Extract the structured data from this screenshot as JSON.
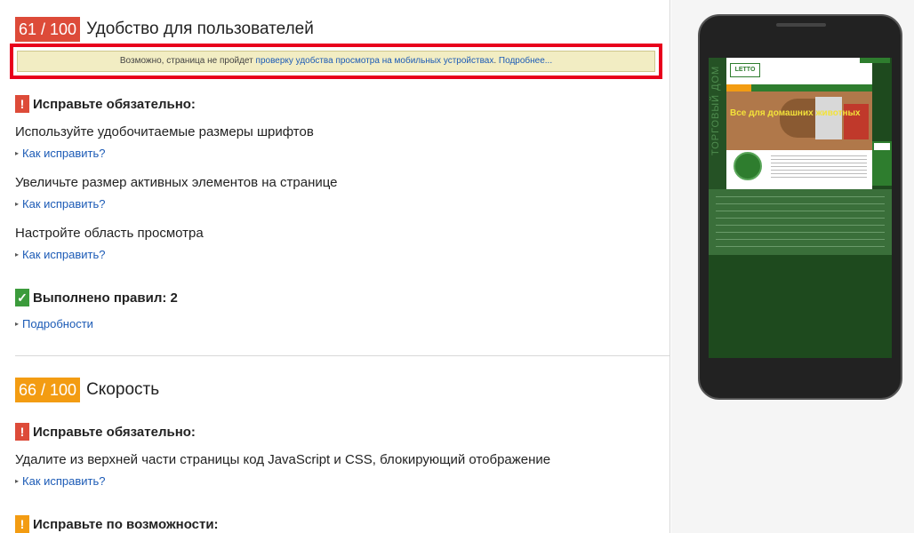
{
  "usability": {
    "score": "61 / 100",
    "title": "Удобство для пользователей",
    "warning_text": "Возможно, страница не пройдет",
    "warning_link": "проверку удобства просмотра на мобильных устройствах",
    "warning_more": "Подробнее...",
    "must_fix_label": "Исправьте обязательно:",
    "items": [
      {
        "text": "Используйте удобочитаемые размеры шрифтов",
        "link": "Как исправить?"
      },
      {
        "text": "Увеличьте размер активных элементов на странице",
        "link": "Как исправить?"
      },
      {
        "text": "Настройте область просмотра",
        "link": "Как исправить?"
      }
    ],
    "passed_label": "Выполнено правил: 2",
    "details_link": "Подробности"
  },
  "speed": {
    "score": "66 / 100",
    "title": "Скорость",
    "must_fix_label": "Исправьте обязательно:",
    "items": [
      {
        "text": "Удалите из верхней части страницы код JavaScript и CSS, блокирующий отображение",
        "link": "Как исправить?"
      }
    ],
    "should_fix_label": "Исправьте по возможности:"
  },
  "preview": {
    "logo": "LETTO",
    "sidebar_text": "ТОРГОВЫЙ ДОМ",
    "banner_text": "Все для домашних животных"
  },
  "colors": {
    "score_red": "#dd4b39",
    "score_orange": "#f39c12",
    "pass_green": "#3c9b3c",
    "link_blue": "#1c5bb6",
    "highlight_red": "#e8001c"
  },
  "icons": {
    "error": "!",
    "pass": "✓",
    "triangle": "▸"
  }
}
